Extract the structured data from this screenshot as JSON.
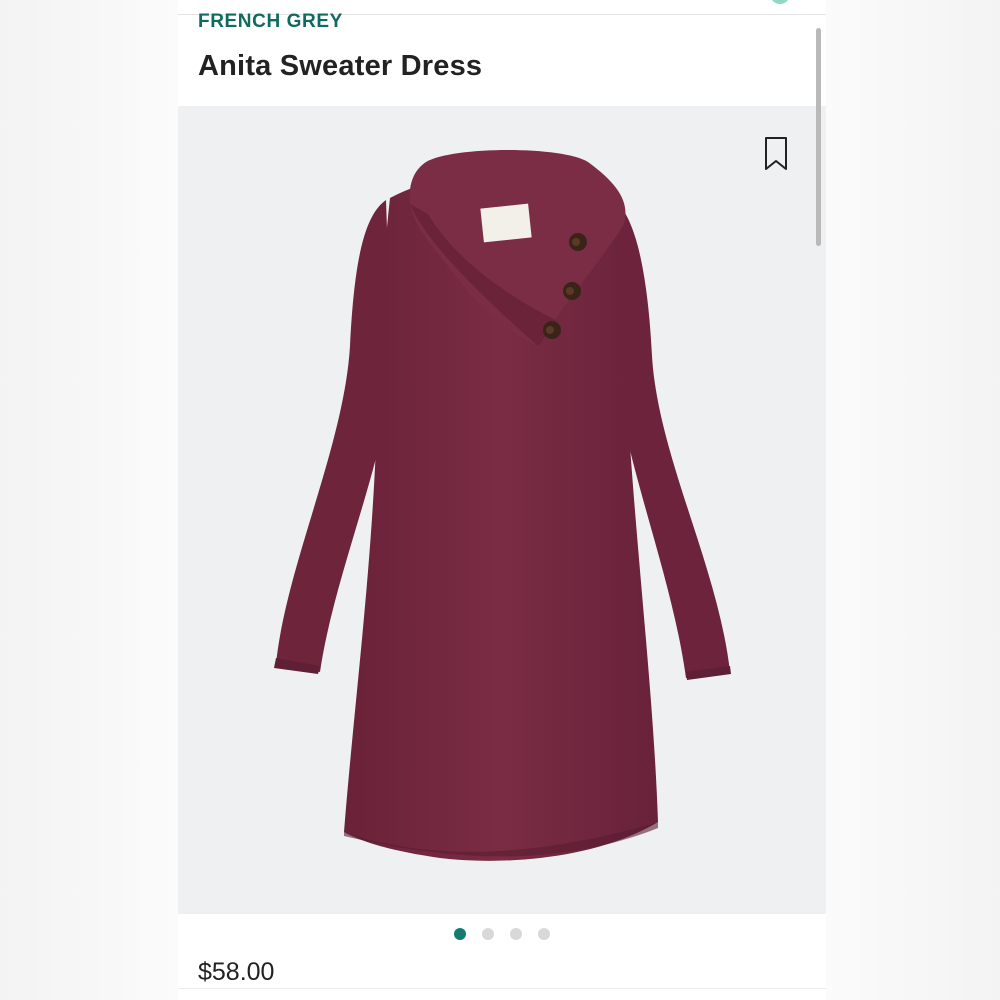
{
  "product": {
    "brand": "FRENCH GREY",
    "title": "Anita Sweater Dress",
    "price": "$58.00"
  },
  "image": {
    "subject": "dress-image",
    "bookmark_icon": "bookmark-icon",
    "current_slide": 1,
    "total_slides": 4
  },
  "colors": {
    "brand_text": "#0f6b5f",
    "accent": "#137c6f",
    "image_background": "#eef0f2",
    "dress": "#74283f"
  }
}
